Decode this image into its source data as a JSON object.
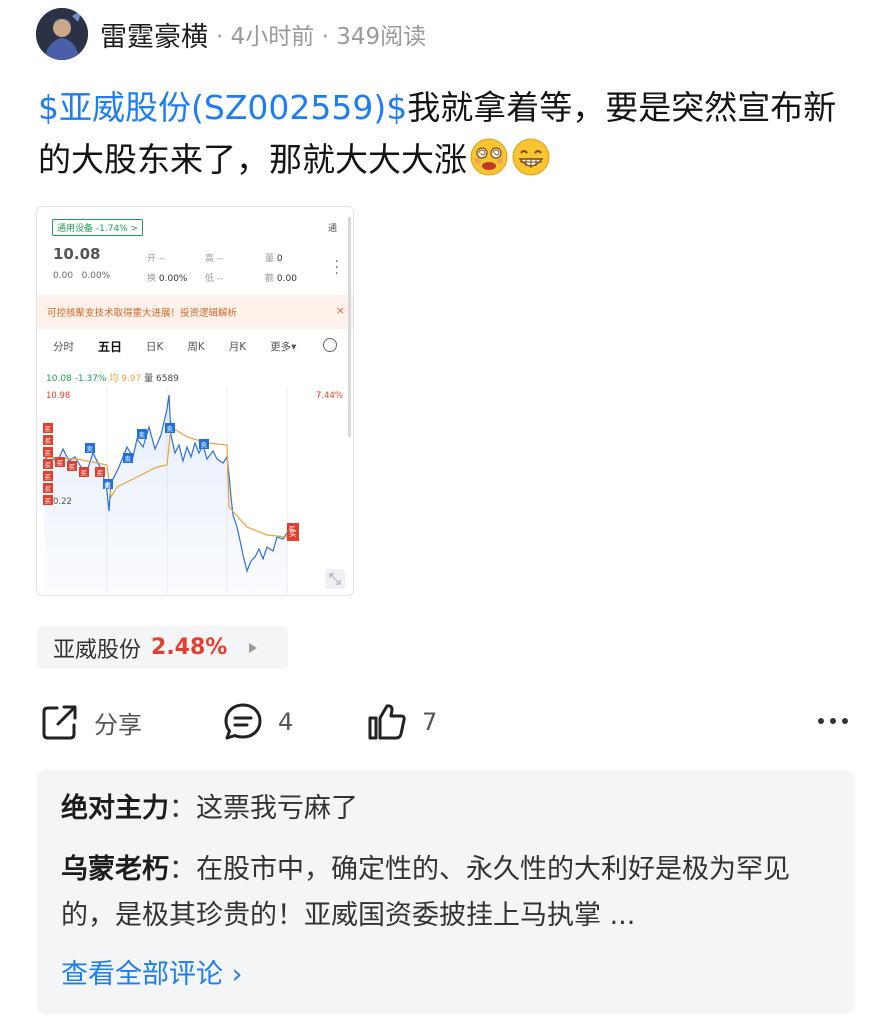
{
  "post": {
    "author": "雷霆豪横",
    "time": "4小时前",
    "reads": "349阅读",
    "stock_link": "$亚威股份(SZ002559)$",
    "body_text": "我就拿着等，要是突然宣布新的大股东来了，那就大大大涨"
  },
  "screenshot": {
    "sector_tag": "通用设备 -1.74% >",
    "tong": "通",
    "price": "10.08",
    "change_abs": "0.00",
    "change_pct": "0.00%",
    "open_label": "开",
    "open_value": "--",
    "high_label": "高",
    "high_value": "--",
    "volume_label": "量",
    "volume_value": "0",
    "turnover_label": "换",
    "turnover_value": "0.00%",
    "low_label": "低",
    "low_value": "--",
    "amount_label": "额",
    "amount_value": "0.00",
    "banner_text": "可控核聚变技术取得重大进展！投资逻辑解析",
    "banner_close": "×",
    "tabs": [
      "分时",
      "五日",
      "日K",
      "周K",
      "月K",
      "更多▾"
    ],
    "line_price": "10.08",
    "line_pct": "-1.37%",
    "line_avg": "均 9.97",
    "line_vol": "量 6589",
    "axis_high": "10.98",
    "axis_high_pct": "7.44%",
    "axis_low": "0.22",
    "buy_label": "买",
    "sell_label": "卖",
    "colors": {
      "up": "#e2402f",
      "down": "#1f9d55",
      "price_line": "#2f6fd6",
      "avg_line": "#e8a33c"
    }
  },
  "stock_tag": {
    "name": "亚威股份",
    "pct": "2.48%"
  },
  "actions": {
    "share_label": "分享",
    "comment_count": "4",
    "like_count": "7"
  },
  "comments": [
    {
      "author": "绝对主力",
      "sep": "：",
      "text": "这票我亏麻了"
    },
    {
      "author": "乌蒙老朽",
      "sep": "：",
      "text": "在股市中，确定性的、永久性的大利好是极为罕见的，是极其珍贵的！亚威国资委披挂上马执掌 ..."
    }
  ],
  "view_all": "查看全部评论 ›"
}
